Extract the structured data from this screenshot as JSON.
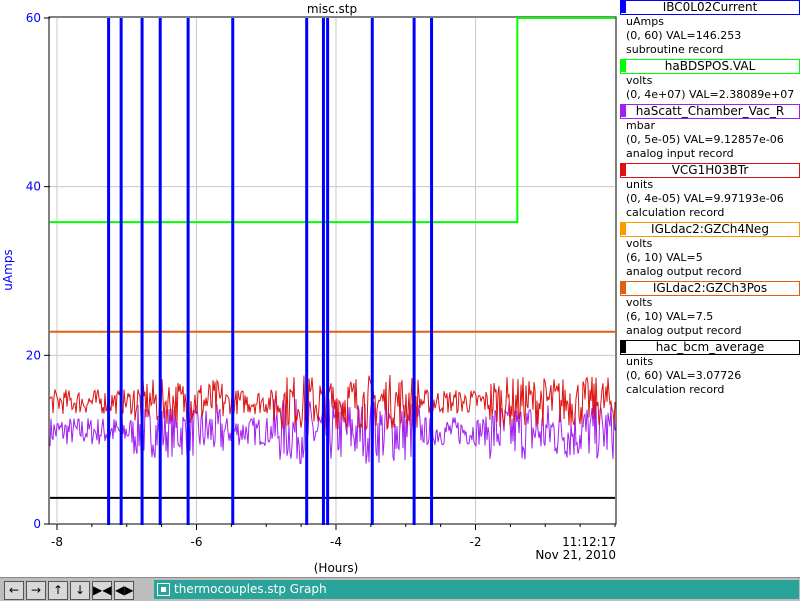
{
  "chart_data": {
    "type": "line",
    "title": "misc.stp",
    "xlabel": "(Hours)",
    "ylabel": "uAmps",
    "xlim": [
      -8.1,
      0
    ],
    "ylim": [
      0,
      60
    ],
    "x_ticks": [
      "-8",
      "-6",
      "-4",
      "-2"
    ],
    "x_tick_values": [
      -8,
      -6,
      -4,
      -2
    ],
    "y_ticks": [
      "0",
      "20",
      "40",
      "60"
    ],
    "y_tick_values": [
      0,
      20,
      40,
      60
    ],
    "timestamp_time": "11:12:17",
    "timestamp_date": "Nov 21, 2010",
    "grid": true,
    "series": [
      {
        "name": "IBC0L02Current",
        "color": "#0000ff",
        "spikes_x": [
          -7.26,
          -7.08,
          -6.78,
          -6.52,
          -6.12,
          -5.48,
          -4.42,
          -4.18,
          -4.12,
          -3.48,
          -2.88,
          -2.63
        ],
        "baseline": 0
      },
      {
        "name": "haBDSPOS.VAL",
        "color": "#00ff00",
        "x": [
          -8.1,
          -1.4,
          -1.4,
          0
        ],
        "values": [
          35.8,
          35.8,
          60,
          60
        ]
      },
      {
        "name": "haScatt_Chamber_Vac_R",
        "color": "#a020f0",
        "noisy": true,
        "base": 11,
        "range": [
          8,
          19
        ]
      },
      {
        "name": "VCG1H03BTr",
        "color": "#dd1111",
        "noisy": true,
        "base": 14.5,
        "range": [
          10,
          25
        ]
      },
      {
        "name": "IGLdac2:GZCh4Neg",
        "color": "#ff9900",
        "x": [
          -8.1,
          0
        ],
        "values": [
          22.8,
          22.8
        ]
      },
      {
        "name": "IGLdac2:GZCh3Pos",
        "color": "#e06010",
        "x": [
          -8.1,
          0
        ],
        "values": [
          22.8,
          22.8
        ]
      },
      {
        "name": "hac_bcm_average",
        "color": "#000000",
        "x": [
          -8.1,
          0
        ],
        "values": [
          3.1,
          3.1
        ]
      }
    ]
  },
  "legend": [
    {
      "name": "IBC0L02Current",
      "color": "#0000ff",
      "unit": "uAmps",
      "range_val": "(0, 60) VAL=146.253",
      "record": "subroutine record"
    },
    {
      "name": "haBDSPOS.VAL",
      "color": "#00ff00",
      "unit": "volts",
      "range_val": "(0, 4e+07) VAL=2.38089e+07",
      "record": ""
    },
    {
      "name": "haScatt_Chamber_Vac_R",
      "color": "#a020f0",
      "unit": "mbar",
      "range_val": "(0, 5e-05) VAL=9.12857e-06",
      "record": "analog input record"
    },
    {
      "name": "VCG1H03BTr",
      "color": "#dd1111",
      "unit": "units",
      "range_val": "(0, 4e-05) VAL=9.97193e-06",
      "record": "calculation record"
    },
    {
      "name": "IGLdac2:GZCh4Neg",
      "color": "#ff9900",
      "unit": "volts",
      "range_val": "(6, 10) VAL=5",
      "record": "analog output record"
    },
    {
      "name": "IGLdac2:GZCh3Pos",
      "color": "#e06010",
      "unit": "volts",
      "range_val": "(6, 10) VAL=7.5",
      "record": "analog output record"
    },
    {
      "name": "hac_bcm_average",
      "color": "#000000",
      "unit": "units",
      "range_val": "(0, 60) VAL=3.07726",
      "record": "calculation record"
    }
  ],
  "taskbar": {
    "buttons": [
      {
        "name": "scroll-left-button",
        "glyph": "←"
      },
      {
        "name": "scroll-right-button",
        "glyph": "→"
      },
      {
        "name": "scroll-up-button",
        "glyph": "↑"
      },
      {
        "name": "scroll-down-button",
        "glyph": "↓"
      },
      {
        "name": "zoom-in-button",
        "glyph": "▶◀"
      },
      {
        "name": "zoom-out-button",
        "glyph": "◀▶"
      }
    ],
    "tab_label": "thermocouples.stp Graph"
  }
}
